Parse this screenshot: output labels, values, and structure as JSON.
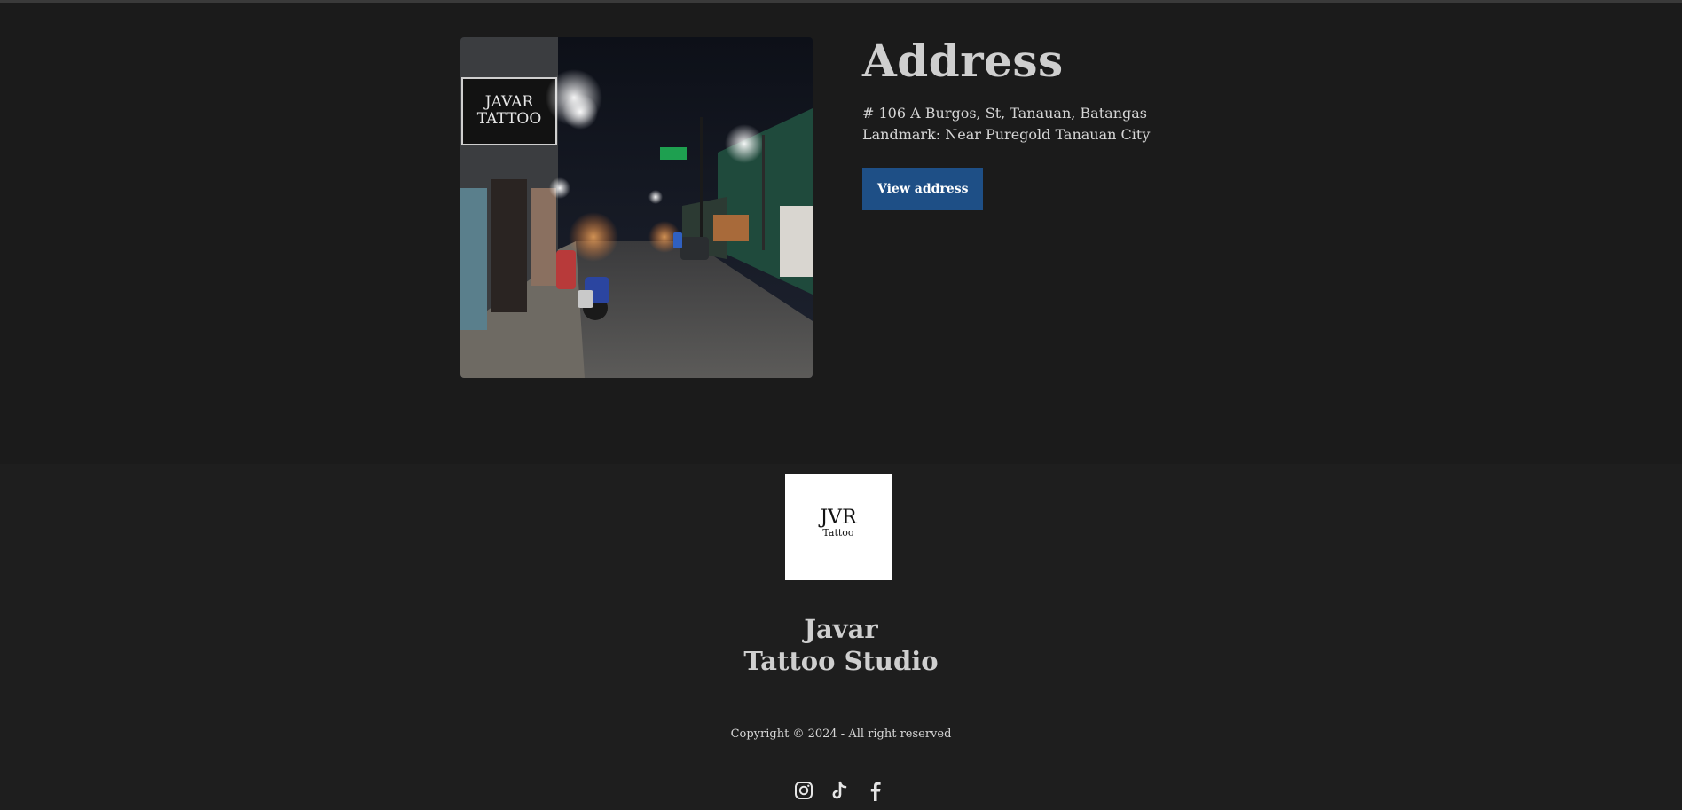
{
  "address": {
    "heading": "Address",
    "line1": "# 106 A Burgos, St, Tanauan, Batangas",
    "line2": "Landmark: Near Puregold Tanauan City",
    "button_label": "View address",
    "photo": {
      "sign_line1": "JAVAR",
      "sign_line2": "TATTOO"
    }
  },
  "footer": {
    "logo_main": "JVR",
    "logo_sub": "Tattoo",
    "studio_line1": "Javar",
    "studio_line2": "Tattoo Studio",
    "copyright": "Copyright © 2024 - All right reserved",
    "socials": [
      "instagram-icon",
      "tiktok-icon",
      "facebook-icon"
    ]
  },
  "colors": {
    "background": "#1b1b1b",
    "footer_background": "#1e1e1e",
    "button": "#1e4f86",
    "text": "#d2d2d2"
  }
}
